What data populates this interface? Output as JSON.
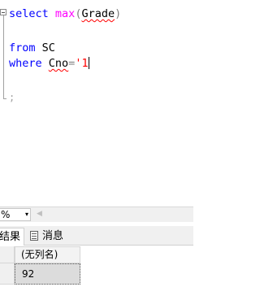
{
  "editor": {
    "lines": [
      {
        "kw1": "select",
        "fn": "max",
        "p1": "(",
        "arg": "Grade",
        "p2": ")"
      },
      {},
      {
        "kw1": "from",
        "ident": "SC"
      },
      {
        "kw1": "where",
        "ident": "Cno",
        "op": "=",
        "str": "'1"
      }
    ],
    "terminator": ";"
  },
  "statusbar": {
    "zoom": "%",
    "zoom_dropdown_icon": "▾",
    "scroll_left_icon": "◀"
  },
  "tabs": {
    "results": "结果",
    "messages": "消息"
  },
  "grid": {
    "columns": [
      "(无列名)"
    ],
    "rows": [
      [
        "92"
      ]
    ]
  }
}
